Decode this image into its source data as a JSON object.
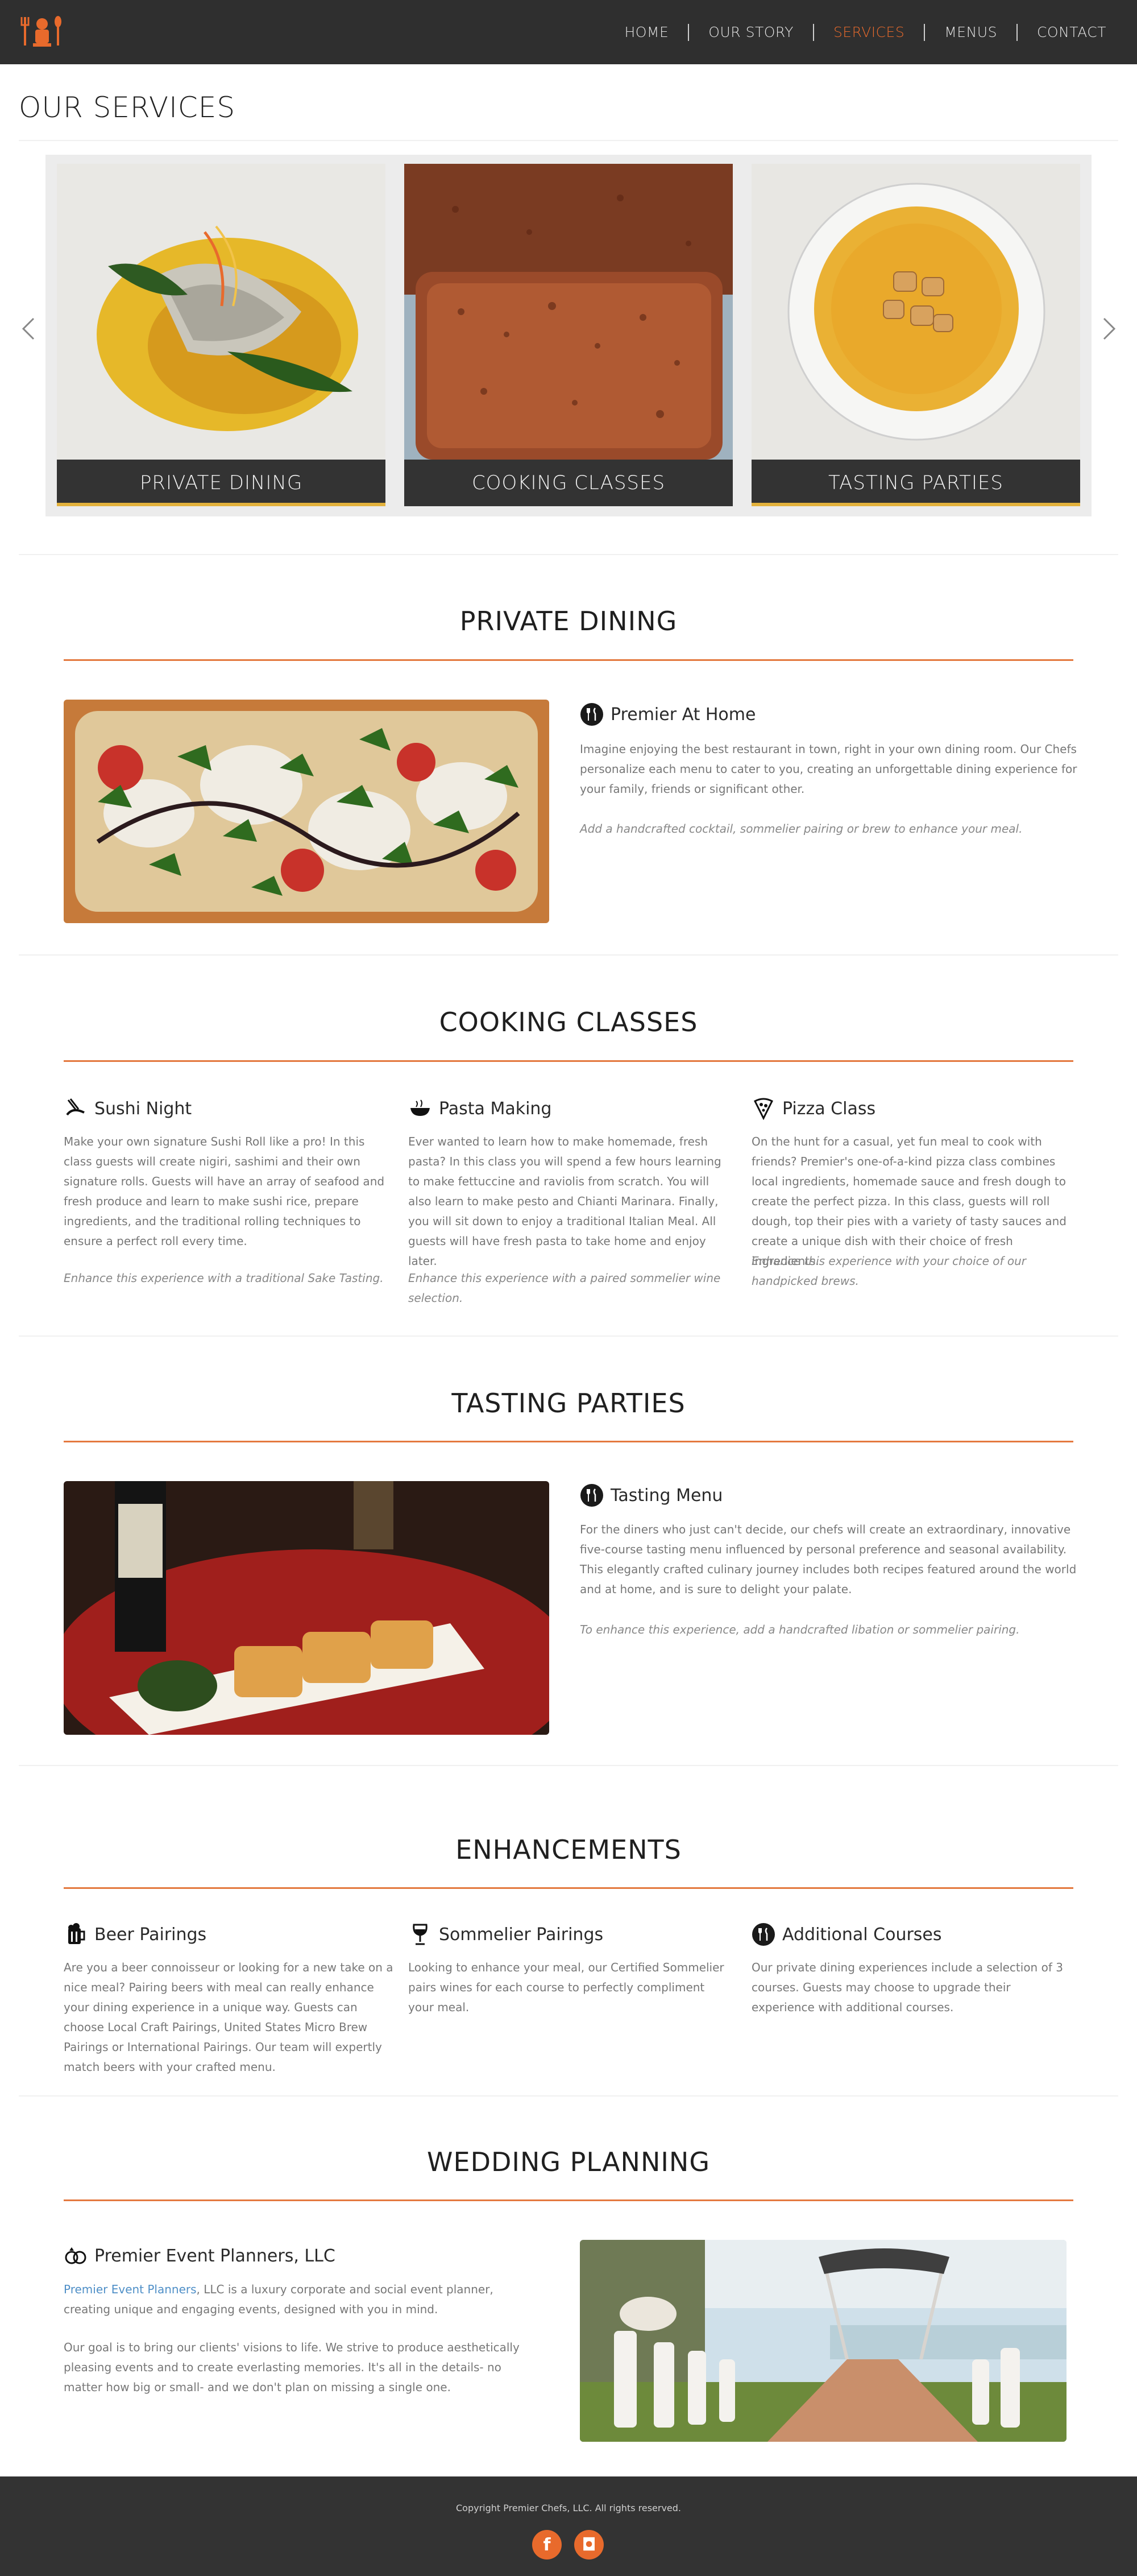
{
  "nav": {
    "items": [
      {
        "label": "HOME"
      },
      {
        "label": "OUR STORY"
      },
      {
        "label": "SERVICES"
      },
      {
        "label": "MENUS"
      },
      {
        "label": "CONTACT"
      }
    ],
    "active": "SERVICES"
  },
  "page": {
    "title": "OUR SERVICES"
  },
  "carousel": {
    "cards": [
      {
        "label": "PRIVATE DINING"
      },
      {
        "label": "COOKING CLASSES"
      },
      {
        "label": "TASTING PARTIES"
      }
    ]
  },
  "private_dining": {
    "title": "PRIVATE DINING",
    "feature_title": "Premier At Home",
    "paragraph": "Imagine enjoying the best restaurant in town, right in your own dining room. Our Chefs personalize each menu to cater to you, creating an unforgettable dining experience for your family, friends or significant other.",
    "note": "Add a handcrafted cocktail, sommelier pairing or brew to enhance your meal."
  },
  "cooking_classes": {
    "title": "COOKING CLASSES",
    "columns": [
      {
        "title": "Sushi Night",
        "icon": "sushi-icon",
        "text": "Make your own signature Sushi Roll like a pro! In this class guests will create nigiri, sashimi and their own signature rolls. Guests will have an array of seafood and fresh produce and learn to make sushi rice, prepare ingredients, and the traditional rolling techniques to ensure a perfect roll every time.",
        "note": "Enhance this experience with a traditional Sake Tasting."
      },
      {
        "title": "Pasta Making",
        "icon": "pasta-bowl-icon",
        "text": "Ever wanted to learn how to make homemade, fresh pasta? In this class you will spend a few hours learning to make fettuccine and raviolis from scratch. You will also learn to make pesto and Chianti Marinara. Finally, you will sit down to enjoy a traditional Italian Meal. All guests will have fresh pasta to take home and enjoy later.",
        "note": "Enhance this experience with a paired sommelier wine selection."
      },
      {
        "title": "Pizza Class",
        "icon": "pizza-icon",
        "text": "On the hunt for a casual, yet fun meal to cook with friends? Premier's one-of-a-kind pizza class combines local ingredients, homemade sauce and fresh dough to create the perfect pizza. In this class, guests will roll dough, top their pies with a variety of tasty sauces and create a unique dish with their choice of fresh ingredients.",
        "note": "Enhance this experience with your choice of our handpicked brews."
      }
    ]
  },
  "tasting_parties": {
    "title": "TASTING PARTIES",
    "feature_title": "Tasting Menu",
    "paragraph": "For the diners who just can't decide, our chefs will create an extraordinary, innovative five-course tasting menu influenced by personal preference and seasonal availability. This elegantly crafted culinary journey includes both recipes featured around the world and at home, and is sure to delight your palate.",
    "note": "To enhance this experience, add a handcrafted libation or sommelier pairing."
  },
  "enhancements": {
    "title": "ENHANCEMENTS",
    "columns": [
      {
        "title": "Beer Pairings",
        "icon": "beer-mug-icon",
        "text": "Are you a beer connoisseur or looking for a new take on a nice meal? Pairing beers with meal can really enhance your dining experience in a unique way. Guests can choose Local Craft Pairings, United States Micro Brew Pairings or International Pairings. Our team will expertly match beers with your crafted menu."
      },
      {
        "title": "Sommelier Pairings",
        "icon": "wine-glass-icon",
        "text": "Looking to enhance your meal, our Certified Sommelier pairs wines for each course to perfectly compliment your meal."
      },
      {
        "title": "Additional Courses",
        "icon": "utensils-icon",
        "text": "Our private dining experiences include a selection of 3 courses. Guests may choose to upgrade their experience with additional courses."
      }
    ]
  },
  "wedding": {
    "title": "WEDDING PLANNING",
    "feature_title": "Premier Event Planners, LLC",
    "link_text": "Premier Event Planners",
    "paragraph1_rest": ", LLC is a luxury corporate and social event planner, creating unique and engaging events, designed with you in mind.",
    "paragraph2": "Our goal is to bring our clients' visions to life. We strive to produce aesthetically pleasing events and to create everlasting memories. It's all in the details- no matter how big or small- and we don't plan on missing a single one."
  },
  "footer": {
    "copyright": "Copyright Premier Chefs, LLC. All rights reserved.",
    "social": [
      {
        "icon": "facebook-icon",
        "glyph": "f"
      },
      {
        "icon": "instagram-icon",
        "glyph": "◘"
      }
    ]
  },
  "colors": {
    "accent": "#e86a2c",
    "header_bg": "#2f2f2f",
    "rule": "#e4793f",
    "caption_line": "#e3b23c"
  }
}
